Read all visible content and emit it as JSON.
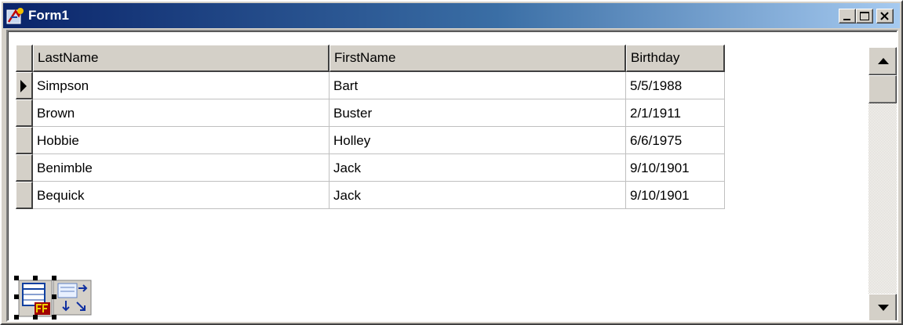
{
  "window": {
    "title": "Form1",
    "app_icon": "delphi-form-icon",
    "caption_buttons": [
      "minimize-icon",
      "maximize-icon",
      "close-icon"
    ]
  },
  "grid": {
    "columns": [
      "LastName",
      "FirstName",
      "Birthday"
    ],
    "rows": [
      [
        "Simpson",
        "Bart",
        "5/5/1988"
      ],
      [
        "Brown",
        "Buster",
        "2/1/1911"
      ],
      [
        "Hobbie",
        "Holley",
        "6/6/1975"
      ],
      [
        "Benimble",
        "Jack",
        "9/10/1901"
      ],
      [
        "Bequick",
        "Jack",
        "9/10/1901"
      ]
    ],
    "current_row_indicator": "triangle-right-icon",
    "selected_row": 0
  },
  "scrollbar": {
    "up_icon": "scroll-up-arrow-icon",
    "down_icon": "scroll-down-arrow-icon"
  },
  "components": [
    "table-component-icon",
    "datasource-component-icon"
  ],
  "colors": {
    "title_gradient_start": "#0a246a",
    "title_gradient_end": "#a6caf0",
    "face": "#d4d0c8"
  }
}
